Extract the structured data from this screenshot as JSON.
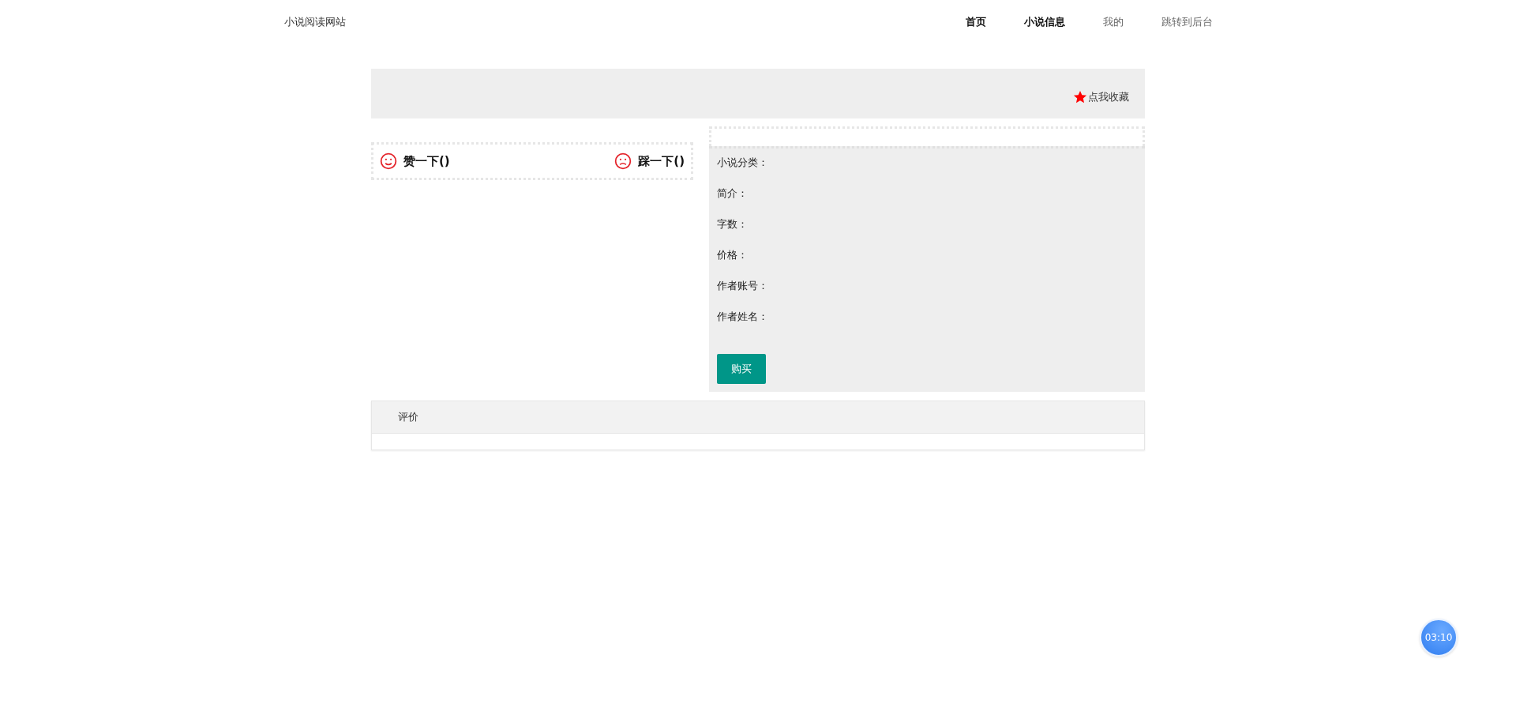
{
  "header": {
    "site_title": "小说阅读网站",
    "nav": [
      {
        "label": "首页",
        "active": true
      },
      {
        "label": "小说信息",
        "active": true
      },
      {
        "label": "我的",
        "active": false
      },
      {
        "label": "跳转到后台",
        "active": false
      }
    ]
  },
  "favorite": {
    "label": "点我收藏"
  },
  "votes": [
    {
      "kind": "like",
      "label": "赞一下()"
    },
    {
      "kind": "dislike",
      "label": "踩一下()"
    }
  ],
  "info_fields": [
    "小说分类：",
    "简介：",
    "字数：",
    "价格：",
    "作者账号：",
    "作者姓名："
  ],
  "buy_button": "购买",
  "reviews": {
    "title": "评价"
  },
  "timer": "03:10"
}
